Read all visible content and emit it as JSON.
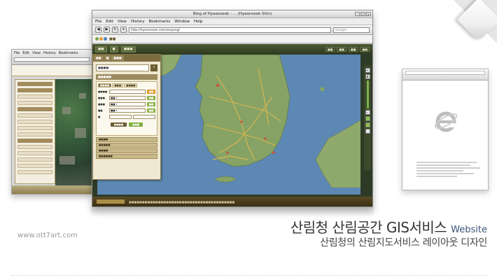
{
  "main_browser": {
    "title": "Blog of Hyeonseok - ... (Hyeonseok Shin)",
    "menu": [
      "File",
      "Edit",
      "View",
      "History",
      "Bookmarks",
      "Window",
      "Help"
    ],
    "url": "http://hyeonseok.com/soojung/",
    "search_placeholder": "Google"
  },
  "caption": {
    "title": "산림청 산림공간 GIS서비스",
    "tag": "Website",
    "subtitle": "산림청의 산림지도서비스 레이아웃 디자인"
  },
  "site_url": "www.ott7art.com",
  "colors": {
    "sidebar_bg": "#efe8d2",
    "sidebar_header": "#7b6b3f",
    "map_sea": "#5d88b3",
    "land": "#86a365",
    "accent_green": "#8fb34c",
    "accent_orange": "#e09a2c",
    "caption_tag": "#3a5478"
  }
}
